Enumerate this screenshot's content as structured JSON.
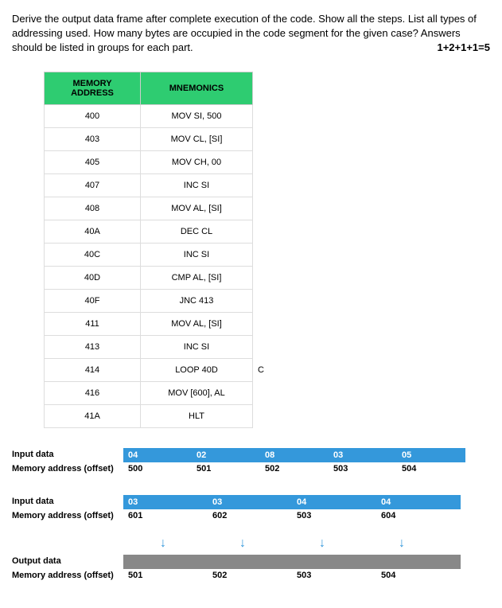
{
  "question": {
    "text": "Derive the output data frame after complete execution of the code. Show all the steps. List all types of addressing used. How many bytes are occupied in the code segment for the given case? Answers should be listed in groups for each part.",
    "marks": "1+2+1+1=5"
  },
  "table": {
    "headers": [
      "MEMORY ADDRESS",
      "MNEMONICS"
    ],
    "rows": [
      {
        "addr": "400",
        "mnem": "MOV SI, 500"
      },
      {
        "addr": "403",
        "mnem": "MOV CL, [SI]"
      },
      {
        "addr": "405",
        "mnem": "MOV CH, 00"
      },
      {
        "addr": "407",
        "mnem": "INC SI"
      },
      {
        "addr": "408",
        "mnem": "MOV AL, [SI]"
      },
      {
        "addr": "40A",
        "mnem": "DEC CL"
      },
      {
        "addr": "40C",
        "mnem": "INC SI"
      },
      {
        "addr": "40D",
        "mnem": "CMP AL, [SI]"
      },
      {
        "addr": "40F",
        "mnem": "JNC 413"
      },
      {
        "addr": "411",
        "mnem": "MOV AL, [SI]"
      },
      {
        "addr": "413",
        "mnem": "INC SI"
      },
      {
        "addr": "414",
        "mnem": "LOOP 40D"
      },
      {
        "addr": "416",
        "mnem": "MOV [600], AL"
      },
      {
        "addr": "41A",
        "mnem": "HLT"
      }
    ],
    "loop_suffix": "C"
  },
  "input1": {
    "label1": "Input data",
    "label2": "Memory address (offset)",
    "values": [
      "04",
      "02",
      "08",
      "03",
      "05"
    ],
    "addrs": [
      "500",
      "501",
      "502",
      "503",
      "504"
    ]
  },
  "input2": {
    "label1": "Input data",
    "label2": "Memory address (offset)",
    "values": [
      "03",
      "03",
      "04",
      "04"
    ],
    "addrs": [
      "601",
      "602",
      "503",
      "604"
    ]
  },
  "output": {
    "label1": "Output data",
    "label2": "Memory address (offset)",
    "addrs": [
      "501",
      "502",
      "503",
      "504"
    ]
  },
  "chart_data": {
    "type": "table",
    "title": "Assembly code listing and memory data frames",
    "code_table": [
      [
        "400",
        "MOV SI, 500"
      ],
      [
        "403",
        "MOV CL, [SI]"
      ],
      [
        "405",
        "MOV CH, 00"
      ],
      [
        "407",
        "INC SI"
      ],
      [
        "408",
        "MOV AL, [SI]"
      ],
      [
        "40A",
        "DEC CL"
      ],
      [
        "40C",
        "INC SI"
      ],
      [
        "40D",
        "CMP AL, [SI]"
      ],
      [
        "40F",
        "JNC 413"
      ],
      [
        "411",
        "MOV AL, [SI]"
      ],
      [
        "413",
        "INC SI"
      ],
      [
        "414",
        "LOOP 40D"
      ],
      [
        "416",
        "MOV [600], AL"
      ],
      [
        "41A",
        "HLT"
      ]
    ],
    "input_frame_1": {
      "500": "04",
      "501": "02",
      "502": "08",
      "503": "03",
      "504": "05"
    },
    "input_frame_2": {
      "601": "03",
      "602": "03",
      "503": "04",
      "604": "04"
    },
    "output_frame": {
      "501": null,
      "502": null,
      "503": null,
      "504": null
    }
  }
}
